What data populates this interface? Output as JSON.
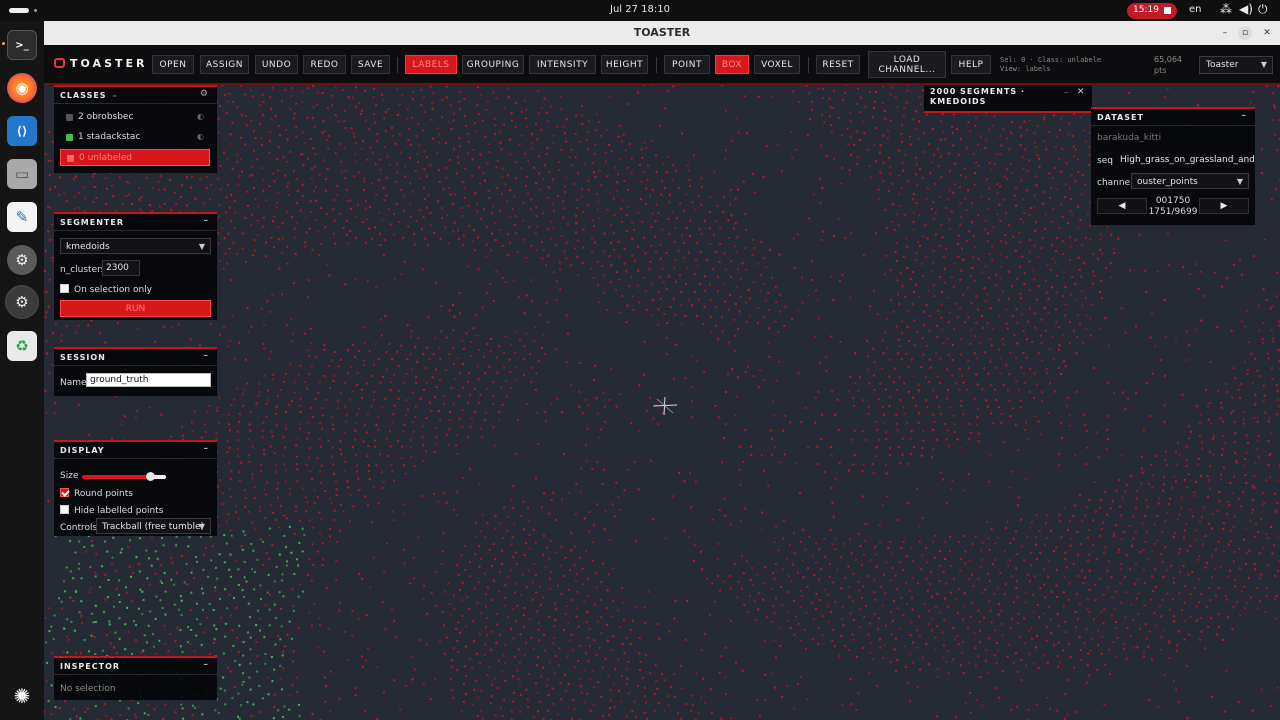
{
  "topbar": {
    "clock": "Jul 27  18:10",
    "recording": "15:19",
    "language": "en",
    "icons": [
      "network-icon",
      "volume-icon",
      "power-icon"
    ]
  },
  "dock": {
    "items": [
      {
        "name": "terminal",
        "glyph": ">_"
      },
      {
        "name": "firefox",
        "glyph": "◉"
      },
      {
        "name": "vscode",
        "glyph": "⟨⟩"
      },
      {
        "name": "files",
        "glyph": "▭"
      },
      {
        "name": "text-editor",
        "glyph": "✎"
      },
      {
        "name": "settings",
        "glyph": "⚙"
      },
      {
        "name": "settings-active",
        "glyph": "⚙"
      },
      {
        "name": "trash",
        "glyph": "♻"
      },
      {
        "name": "ubuntu-apps",
        "glyph": "✺"
      }
    ]
  },
  "window": {
    "title": "TOASTER",
    "controls": [
      "–",
      "▫",
      "✕"
    ]
  },
  "toolbar": {
    "logo": "TOASTER",
    "buttons": {
      "open": "OPEN",
      "assign": "ASSIGN",
      "undo": "UNDO",
      "redo": "REDO",
      "save": "SAVE",
      "labels": "LABELS",
      "grouping": "GROUPING",
      "intensity": "INTENSITY",
      "height": "HEIGHT",
      "point": "POINT",
      "box": "BOX",
      "voxel": "VOXEL",
      "reset": "RESET",
      "load_channel_1": "LOAD",
      "load_channel_2": "CHANNEL...",
      "help": "HELP"
    },
    "status_line1": "Sel: 0 · Class: unlabele",
    "status_line2": "View: labels",
    "pts_count": "65,064",
    "pts_unit": "pts",
    "profile_select": "Toaster"
  },
  "classes_panel": {
    "title": "CLASSES",
    "items": [
      {
        "label": "2 obrobsbec",
        "color": "#555555"
      },
      {
        "label": "1 stadackstac",
        "color": "#3fbf4a"
      },
      {
        "label": "0 unlabeled",
        "color": "#d8171d"
      }
    ]
  },
  "segmenter_panel": {
    "title": "SEGMENTER",
    "algorithm": "kmedoids",
    "n_clusters_label": "n_clusters",
    "n_clusters_value": "2300",
    "on_selection_label": "On selection only",
    "run_label": "RUN"
  },
  "session_panel": {
    "title": "SESSION",
    "name_label": "Name",
    "name_value": "ground_truth"
  },
  "display_panel": {
    "title": "DISPLAY",
    "size_label": "Size",
    "size_level": 0.82,
    "round_points_label": "Round points",
    "round_points": true,
    "hide_labelled_label": "Hide labelled points",
    "hide_labelled": false,
    "controls_label": "Controls",
    "controls_value": "Trackball (free tumble)"
  },
  "inspector_panel": {
    "title": "INSPECTOR",
    "content": "No selection"
  },
  "segments_toast": {
    "line1": "2000 SEGMENTS ·",
    "line2": "KMEDOIDS"
  },
  "dataset_panel": {
    "title": "DATASET",
    "dataset_name": "barakuda_kitti",
    "seq_label": "seq",
    "seq_value": "High_grass_on_grassland_and_hill",
    "channel_label": "channel",
    "channel_value": "ouster_points",
    "frame_id": "001750",
    "frame_counter": "1751/9699",
    "prev_glyph": "◀",
    "next_glyph": "▶"
  },
  "colors": {
    "accent": "#d8171d",
    "point_red": "#c8191e",
    "point_green": "#3fbf4a",
    "viewport_bg": "#252a35"
  }
}
